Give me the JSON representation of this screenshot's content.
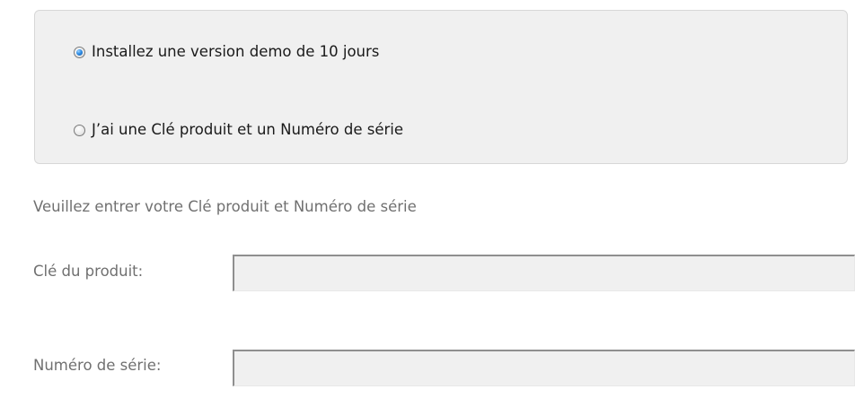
{
  "install_options": {
    "demo": {
      "label": "Installez une version demo de 10 jours",
      "selected": true
    },
    "licensed": {
      "label": "J’ai une Clé produit et un Numéro de  série",
      "selected": false
    }
  },
  "instructions": "Veuillez entrer votre Clé produit et Numéro de  série",
  "fields": {
    "product_key": {
      "label": "Clé du produit:",
      "value": "",
      "enabled": false
    },
    "serial_number": {
      "label": "Numéro de série:",
      "value": "",
      "enabled": false
    }
  },
  "icons": {
    "radio_selected": "radio-selected-icon",
    "radio_unselected": "radio-unselected-icon"
  },
  "colors": {
    "groupbox_background": "#f0f0f0",
    "disabled_text": "#707070",
    "textbox_background": "#f0f0f0",
    "radio_accent": "#2f8ee6"
  }
}
